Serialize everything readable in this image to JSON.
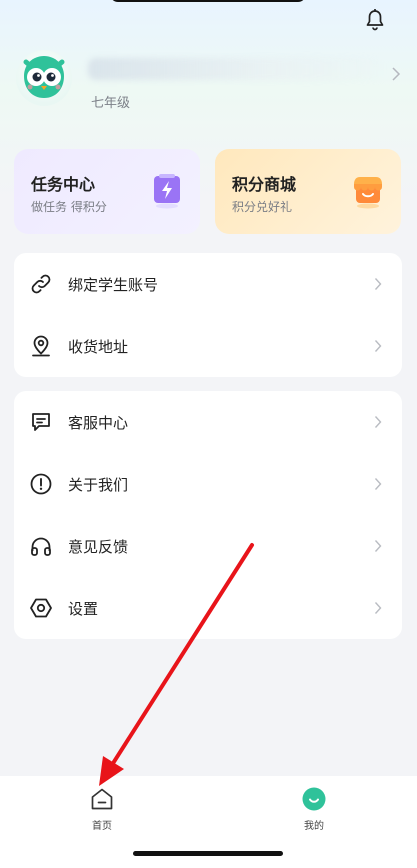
{
  "profile": {
    "grade": "七年级"
  },
  "cards": {
    "task": {
      "title": "任务中心",
      "subtitle": "做任务 得积分"
    },
    "shop": {
      "title": "积分商城",
      "subtitle": "积分兑好礼"
    }
  },
  "menu_group_1": [
    {
      "label": "绑定学生账号",
      "icon": "link-icon"
    },
    {
      "label": "收货地址",
      "icon": "location-pin-icon"
    }
  ],
  "menu_group_2": [
    {
      "label": "客服中心",
      "icon": "chat-icon"
    },
    {
      "label": "关于我们",
      "icon": "info-icon"
    },
    {
      "label": "意见反馈",
      "icon": "headset-icon"
    },
    {
      "label": "设置",
      "icon": "settings-hexagon-icon"
    }
  ],
  "tabbar": {
    "home_label": "首页",
    "mine_label": "我的"
  },
  "colors": {
    "accent_green": "#2fc29a",
    "annotation_arrow": "#e8141a"
  }
}
